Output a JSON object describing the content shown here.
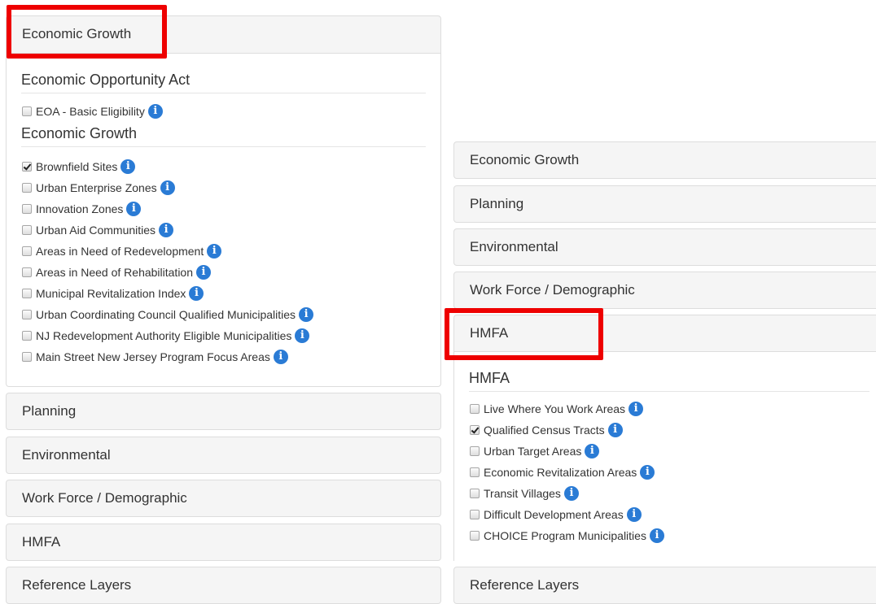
{
  "left": {
    "open_header": "Economic Growth",
    "groups": [
      {
        "title": "Economic Opportunity Act",
        "items": [
          {
            "label": "EOA - Basic Eligibility",
            "checked": false
          }
        ]
      },
      {
        "title": "Economic Growth",
        "items": [
          {
            "label": "Brownfield Sites",
            "checked": true
          },
          {
            "label": "Urban Enterprise Zones",
            "checked": false
          },
          {
            "label": "Innovation Zones",
            "checked": false
          },
          {
            "label": "Urban Aid Communities",
            "checked": false
          },
          {
            "label": "Areas in Need of Redevelopment",
            "checked": false
          },
          {
            "label": "Areas in Need of Rehabilitation",
            "checked": false
          },
          {
            "label": "Municipal Revitalization Index",
            "checked": false
          },
          {
            "label": "Urban Coordinating Council Qualified Municipalities",
            "checked": false
          },
          {
            "label": "NJ Redevelopment Authority Eligible Municipalities",
            "checked": false
          },
          {
            "label": "Main Street New Jersey Program Focus Areas",
            "checked": false
          }
        ]
      }
    ],
    "collapsed": [
      "Planning",
      "Environmental",
      "Work Force / Demographic",
      "HMFA",
      "Reference Layers"
    ]
  },
  "right": {
    "collapsed_top": [
      "Economic Growth",
      "Planning",
      "Environmental",
      "Work Force / Demographic"
    ],
    "open_header": "HMFA",
    "group": {
      "title": "HMFA",
      "items": [
        {
          "label": "Live Where You Work Areas",
          "checked": false
        },
        {
          "label": "Qualified Census Tracts",
          "checked": true
        },
        {
          "label": "Urban Target Areas",
          "checked": false
        },
        {
          "label": "Economic Revitalization Areas",
          "checked": false
        },
        {
          "label": "Transit Villages",
          "checked": false
        },
        {
          "label": "Difficult Development Areas",
          "checked": false
        },
        {
          "label": "CHOICE Program Municipalities",
          "checked": false
        }
      ]
    },
    "collapsed_bottom": [
      "Reference Layers"
    ]
  },
  "icons": {
    "info": "info-icon",
    "info_glyph": "i"
  },
  "colors": {
    "highlight": "#ee0000",
    "info_icon": "#2a7bd5",
    "panel_heading": "#f5f5f5"
  }
}
